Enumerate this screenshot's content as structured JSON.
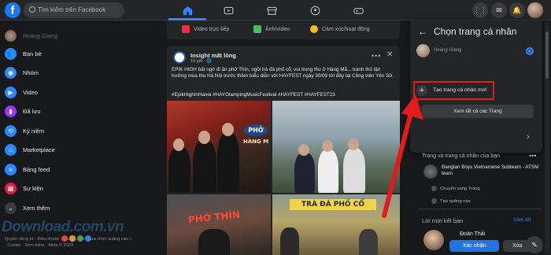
{
  "colors": {
    "background": "#18191a",
    "surface": "#242526",
    "accent": "#2d88ff",
    "highlight": "#e21b1b",
    "brand": "#1877f2"
  },
  "topbar": {
    "logo": "f",
    "search_placeholder": "Tìm kiếm trên Facebook",
    "nav_icons": [
      "home-icon",
      "video-icon",
      "marketplace-icon",
      "groups-icon",
      "gaming-icon"
    ],
    "right_icons": [
      "menu-grid-icon",
      "messenger-icon",
      "bell-icon"
    ],
    "notification_count": "2"
  },
  "sidebar": {
    "profile_name": "Hoàng Giang",
    "items": [
      {
        "label": "Bạn bè",
        "icon": "friends-icon",
        "color": "#2d88ff"
      },
      {
        "label": "Nhóm",
        "icon": "groups-icon",
        "color": "#2d88ff"
      },
      {
        "label": "Video",
        "icon": "video-icon",
        "color": "#2d88ff"
      },
      {
        "label": "Đã lưu",
        "icon": "saved-icon",
        "color": "#a033ff"
      },
      {
        "label": "Kỷ niệm",
        "icon": "memories-icon",
        "color": "#2d88ff"
      },
      {
        "label": "Marketplace",
        "icon": "marketplace-icon",
        "color": "#2d88ff"
      },
      {
        "label": "Bảng feed",
        "icon": "feed-icon",
        "color": "#2d88ff"
      },
      {
        "label": "Sự kiện",
        "icon": "events-icon",
        "color": "#e41e3f"
      },
      {
        "label": "Xem thêm",
        "icon": "chevron-down-icon",
        "color": "#3a3b3c"
      }
    ],
    "footer": "Quyền riêng tư · Điều khoản · Quảng cáo · Lựa chọn quảng cáo ▷ · Cookie · Xem thêm · Meta © 2023",
    "watermark": "Download.com.vn"
  },
  "composer": {
    "actions": [
      {
        "label": "Video trực tiếp",
        "icon": "live-video-icon",
        "color": "#f02849"
      },
      {
        "label": "Ảnh/video",
        "icon": "photo-icon",
        "color": "#45bd62"
      },
      {
        "label": "Cảm xúc/hoạt động",
        "icon": "feeling-icon",
        "color": "#f7b928"
      }
    ]
  },
  "post": {
    "author": "Insight mất lòng",
    "time": "19 giờ · 🌐",
    "text": "EPIK HIGH bất ngờ đi ăn phở Thìn, ngồi trà đá phố cổ, vui trung thu ở Hàng Mã... tranh thủ tận hưởng mùa thu Hà Nội trước thềm biểu diễn với HAYFEST ngày 30/09 tới đây tại Công viên Yên Sở.",
    "tags": "#EpikHighInHanoi #HAYGlampingMusicFestival #HAYFEST #HAYFEST23",
    "photo_signs": {
      "sign1": "PHỞ",
      "sign1b": "HÀNG M",
      "sign2": "TRÀ ĐÁ PHỐ CỔ",
      "sign3": "PHỞ THÌN"
    }
  },
  "panel": {
    "title": "Chọn trang cá nhân",
    "profile_name": "Hoàng Giang",
    "create_label": "Tạo trang cá nhân mới",
    "see_all_label": "Xem tất cả các Trang"
  },
  "pages": {
    "title": "Trang và trang cá nhân của bạn",
    "page_name": "Bangtan Boys Vietnamese Subteam - ATSM team",
    "actions": [
      "Chuyển sang Trang",
      "Tạo quảng cáo"
    ]
  },
  "friend_requests": {
    "title": "Lời mời kết bạn",
    "see_all": "Xem tất",
    "name": "Đoàn Thái",
    "accept": "Xác nhận",
    "delete": "Xóa"
  }
}
